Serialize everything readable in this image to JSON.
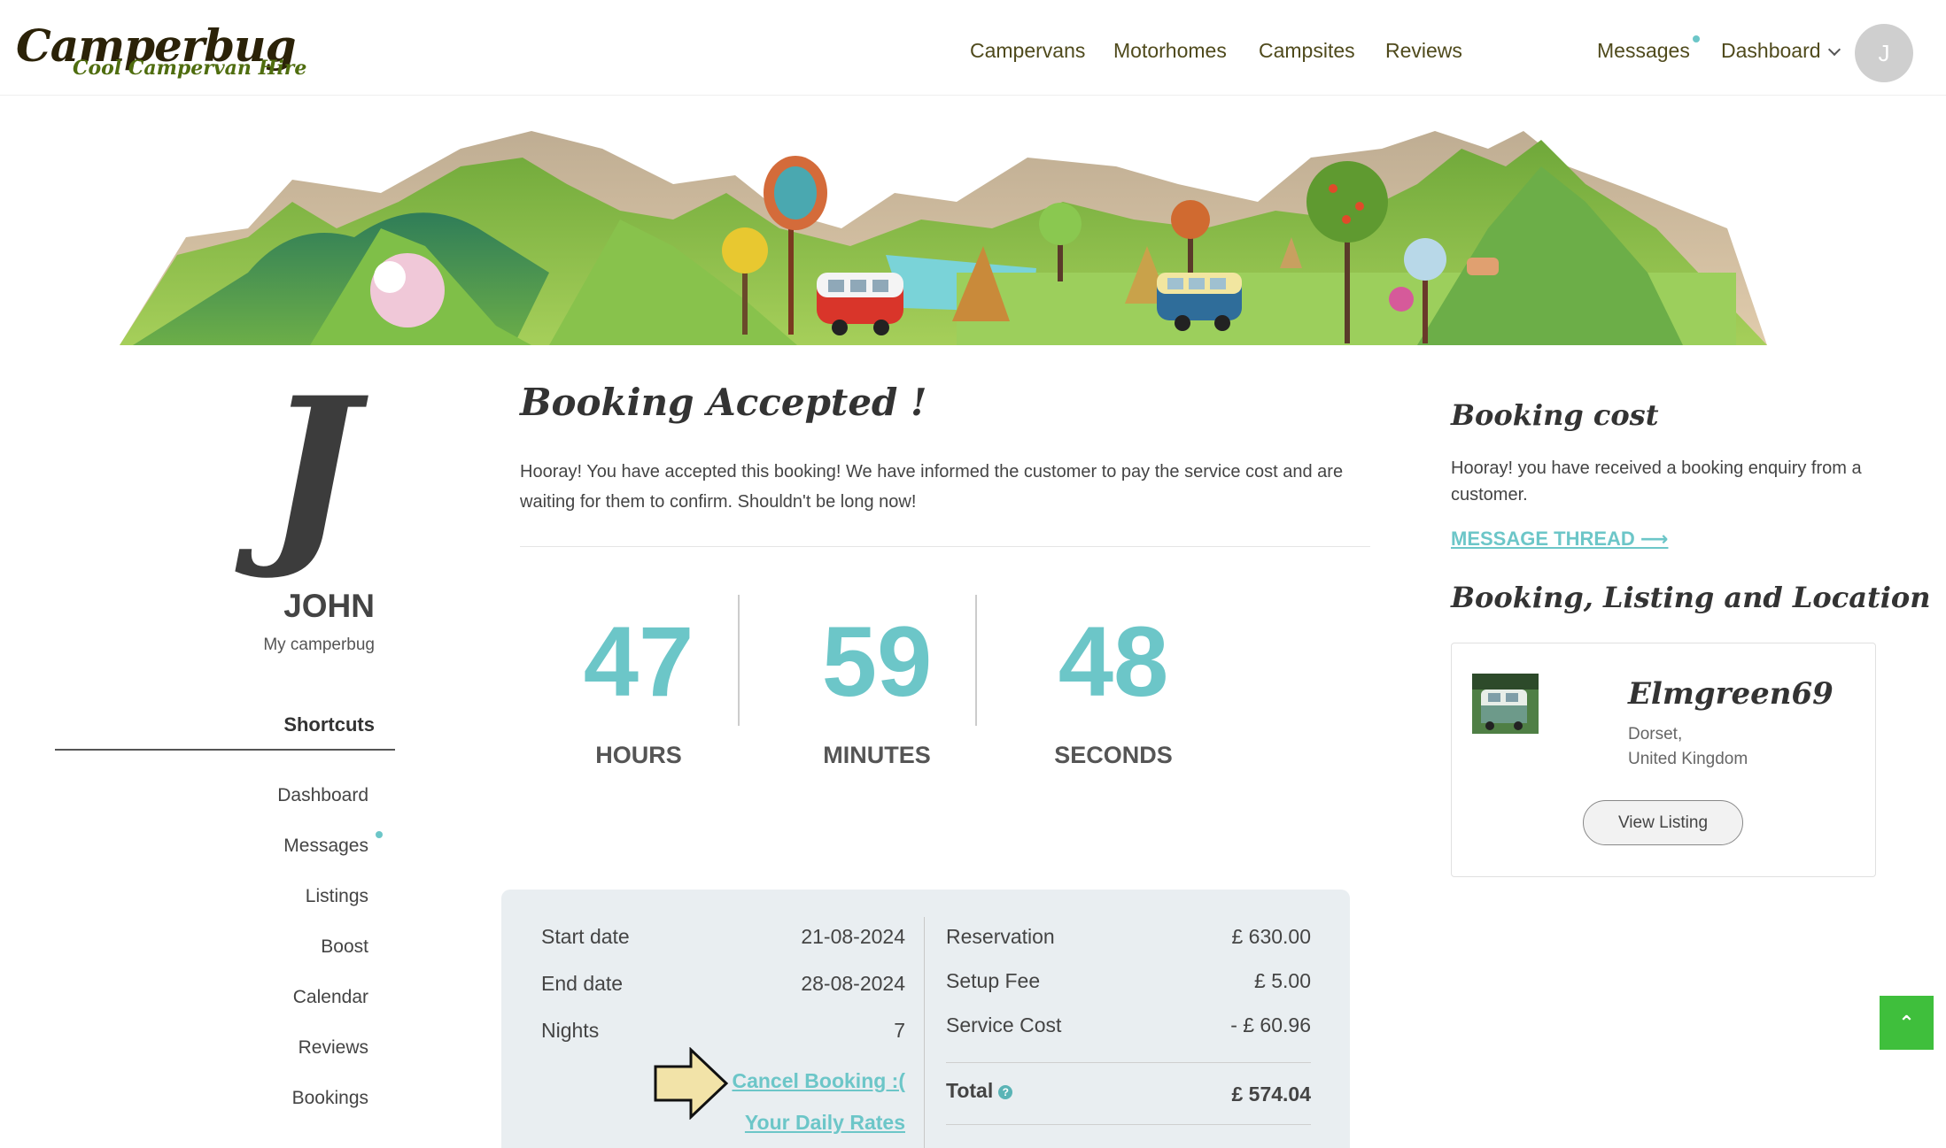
{
  "header": {
    "logo_main": "Camperbug",
    "logo_sub": "Cool Campervan Hire",
    "nav": [
      "Campervans",
      "Motorhomes",
      "Campsites",
      "Reviews"
    ],
    "messages": "Messages",
    "dashboard": "Dashboard",
    "avatar_initial": "J"
  },
  "sidebar": {
    "initial": "J",
    "name": "JOHN",
    "subtitle": "My camperbug",
    "shortcuts_title": "Shortcuts",
    "items": [
      "Dashboard",
      "Messages",
      "Listings",
      "Boost",
      "Calendar",
      "Reviews",
      "Bookings"
    ]
  },
  "main": {
    "title": "Booking Accepted !",
    "intro": "Hooray! You have accepted this booking! We have informed the customer to pay the service cost and are waiting for them to confirm. Shouldn't be long now!",
    "countdown": [
      {
        "value": "47",
        "label": "HOURS"
      },
      {
        "value": "59",
        "label": "MINUTES"
      },
      {
        "value": "48",
        "label": "SECONDS"
      }
    ],
    "booking": {
      "start_label": "Start date",
      "start_value": "21-08-2024",
      "end_label": "End date",
      "end_value": "28-08-2024",
      "nights_label": "Nights",
      "nights_value": "7",
      "cancel_link": "Cancel Booking :(",
      "rates_link": "Your Daily Rates"
    },
    "costs": {
      "reservation_label": "Reservation",
      "reservation_value": "£ 630.00",
      "setup_label": "Setup Fee",
      "setup_value": "£ 5.00",
      "service_label": "Service Cost",
      "service_value": "- £ 60.96",
      "total_label": "Total",
      "total_value": "£ 574.04"
    }
  },
  "right": {
    "cost_title": "Booking cost",
    "cost_text": "Hooray! you have received a booking enquiry from a customer.",
    "message_link": "MESSAGE THREAD ⟶",
    "listing_title": "Booking, Listing and Location",
    "listing_name": "Elmgreen69",
    "location_line1": "Dorset,",
    "location_line2": "United Kingdom",
    "view_button": "View Listing"
  },
  "colors": {
    "accent": "#6cc6c8",
    "back_to_top": "#3fbf3c"
  }
}
